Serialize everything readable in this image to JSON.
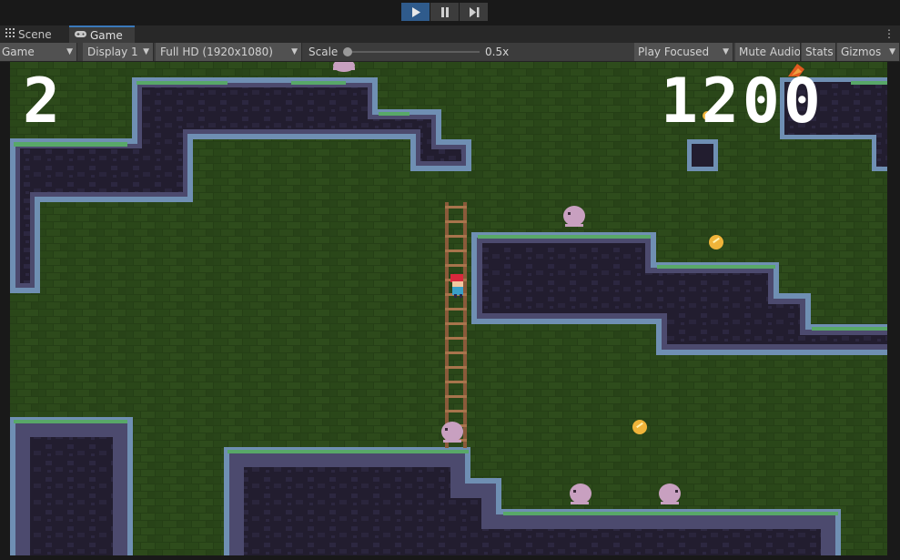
{
  "toolbar_top": {
    "play_icon": "play-icon",
    "pause_icon": "pause-icon",
    "step_icon": "step-icon"
  },
  "tabs": {
    "scene": {
      "label": "Scene",
      "icon": "grid-icon"
    },
    "game": {
      "label": "Game",
      "icon": "gamepad-icon"
    }
  },
  "game_toolbar": {
    "view_mode": "Game",
    "display": "Display 1",
    "resolution": "Full HD (1920x1080)",
    "scale_label": "Scale",
    "scale_value": "0.5x",
    "scale_fraction": 0.0,
    "play_mode": "Play Focused",
    "mute_audio": "Mute Audio",
    "stats": "Stats",
    "gizmos": "Gizmos"
  },
  "hud": {
    "lives": "2",
    "score": "1200"
  },
  "colors": {
    "background_wall": "#253f16",
    "rock": "#221d2f",
    "rock_edge": "#6f8fb3",
    "grass": "#58a868",
    "ladder": "#8a5a3a",
    "coin": "#f0b43a",
    "enemy": "#c8a0c0",
    "player_hair": "#d8283c"
  },
  "entities": {
    "player": "player-character",
    "ladder": "ladder",
    "enemies": [
      "enemy-blob",
      "enemy-blob",
      "enemy-blob",
      "enemy-blob",
      "enemy-blob"
    ],
    "coins": [
      "coin",
      "coin",
      "coin"
    ]
  }
}
